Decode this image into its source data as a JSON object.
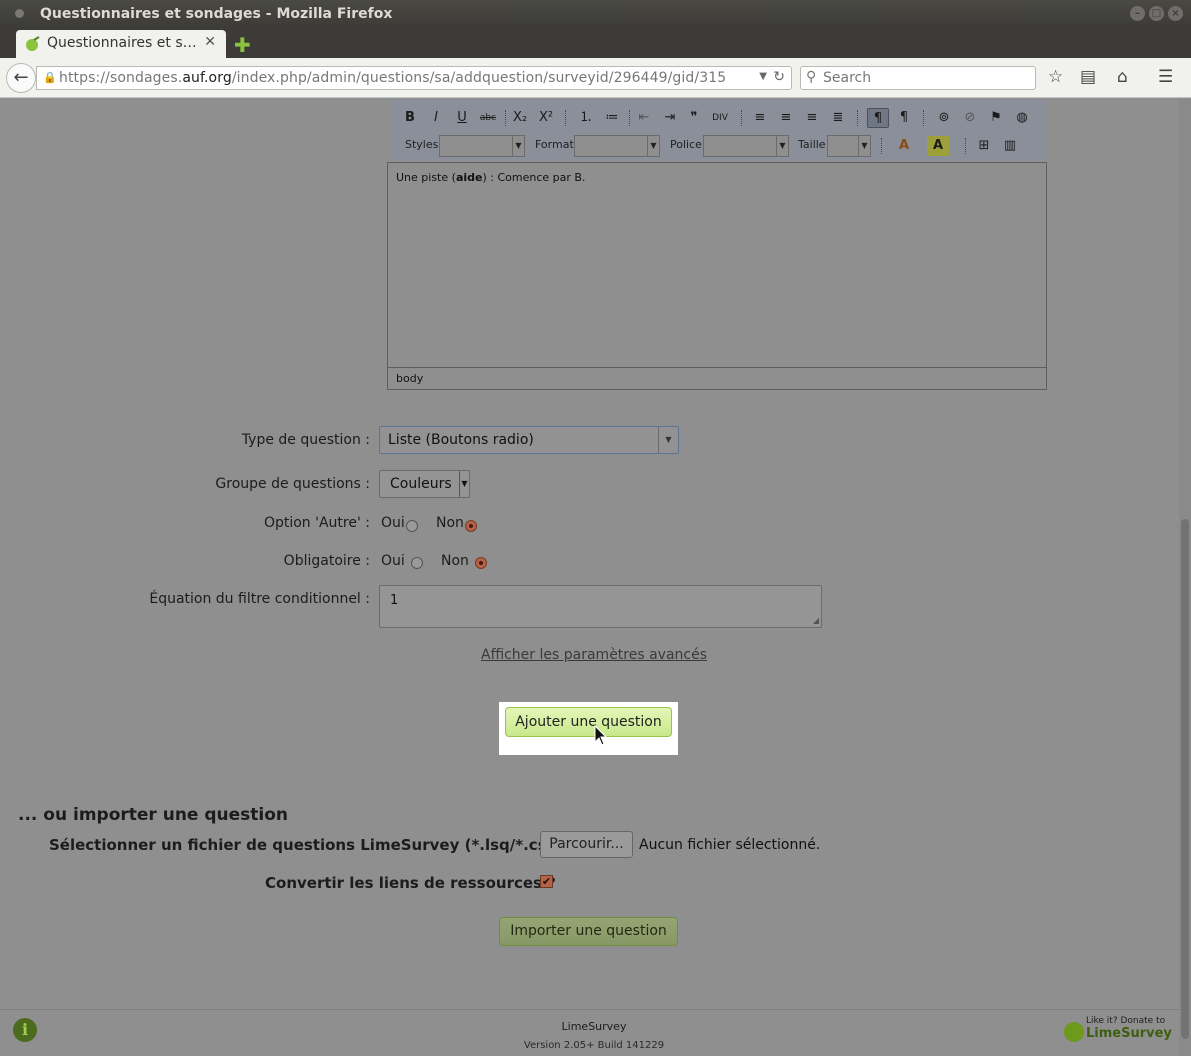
{
  "window": {
    "title": "Questionnaires et sondages - Mozilla Firefox",
    "tab_title": "Questionnaires et sondages",
    "tab_close": "✕",
    "new_tab": "✚"
  },
  "navbar": {
    "url_prefix": "https://sondages.",
    "url_domain": "auf.org",
    "url_path": "/index.php/admin/questions/sa/addquestion/surveyid/296449/gid/315",
    "search_placeholder": "Search"
  },
  "editor_toolbar": {
    "row1": [
      "B",
      "I",
      "U",
      "abc",
      "X₂",
      "X²"
    ],
    "styles_label": "Styles",
    "format_label": "Format",
    "police_label": "Police",
    "taille_label": "Taille",
    "text_color": "A",
    "bg_color": "A"
  },
  "editor": {
    "content_before": "Une piste (",
    "content_bold": "aide",
    "content_after": ") : Comence par B.",
    "path": "body"
  },
  "form": {
    "type_label": "Type de question :",
    "type_value": "Liste (Boutons radio)",
    "group_label": "Groupe de questions :",
    "group_value": "Couleurs",
    "other_label": "Option 'Autre' :",
    "other_yes": "Oui",
    "other_no": "Non",
    "other_selected": "Non",
    "mandatory_label": "Obligatoire :",
    "mandatory_yes": "Oui",
    "mandatory_no": "Non",
    "mandatory_selected": "Non",
    "filter_label": "Équation du filtre conditionnel :",
    "filter_value": "1",
    "advanced_link": "Afficher les paramètres avancés",
    "add_button": "Ajouter une question"
  },
  "import": {
    "title": "... ou importer une question",
    "file_label": "Sélectionner un fichier de questions LimeSurvey (*.lsq/*.csv):",
    "browse_button": "Parcourir...",
    "no_file": "Aucun fichier sélectionné.",
    "convert_label": "Convertir les liens de ressources ?",
    "convert_checked": true,
    "import_button": "Importer une question"
  },
  "footer": {
    "name": "LimeSurvey",
    "version": "Version 2.05+ Build 141229",
    "donate_line1": "Like it? Donate to",
    "donate_line2": "LimeSurvey"
  },
  "icons": {
    "info": "info-icon",
    "back": "back-arrow-icon",
    "lock": "lock-icon"
  }
}
